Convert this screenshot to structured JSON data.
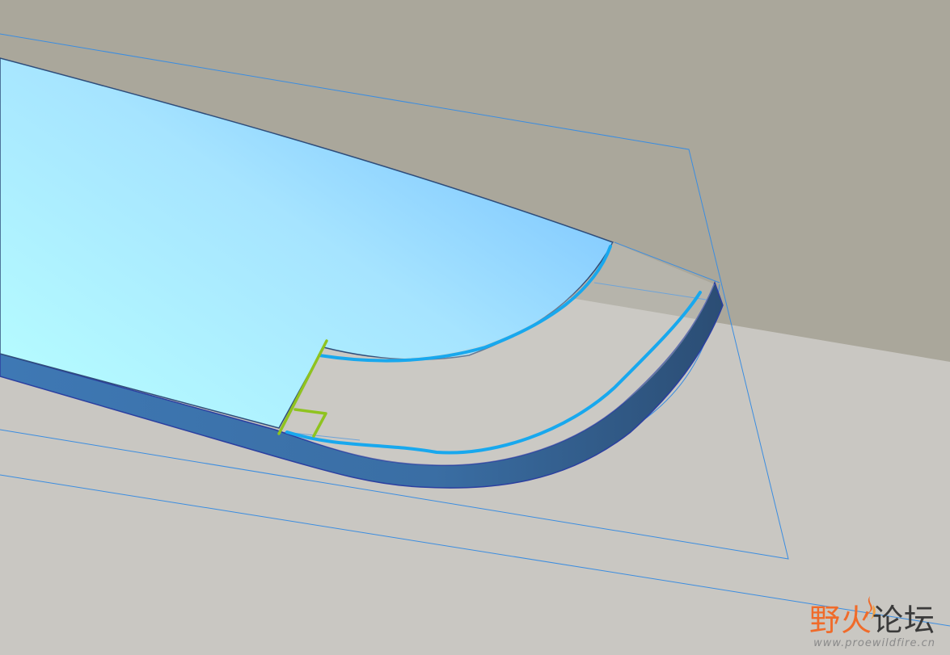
{
  "watermark": {
    "title_chars": [
      "野",
      "火",
      "论",
      "坛"
    ],
    "url": "www.proewildfire.cn",
    "icon": "flame-icon"
  },
  "colors": {
    "background_upper": "#a9a69a",
    "background_lower": "#c9c7c2",
    "part_surface_light": "#b6fdff",
    "part_surface_dark": "#7cc6ff",
    "part_edge": "#3c6d9e",
    "datum_plane_lines": "#3b8de0",
    "highlight_curve": "#18a8ee",
    "sketch_mark": "#8fc31f",
    "watermark_orange": "#f06b2a"
  }
}
